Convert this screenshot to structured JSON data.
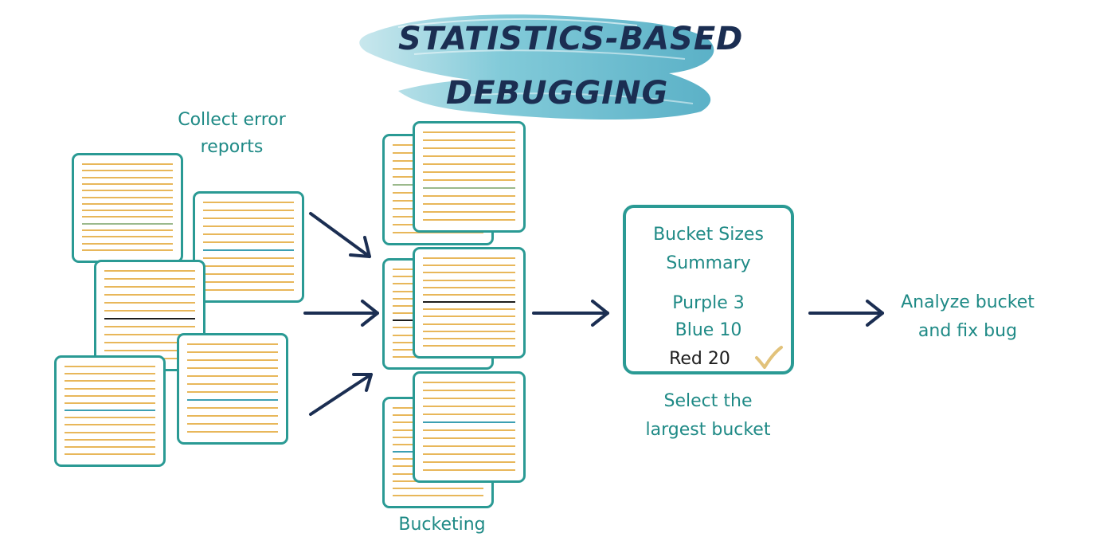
{
  "title": {
    "line1": "STATISTICS-BASED",
    "line2": "DEBUGGING"
  },
  "steps": {
    "collect": {
      "line1": "Collect error",
      "line2": "reports"
    },
    "bucketing": "Bucketing",
    "select": {
      "line1": "Select the",
      "line2": "largest bucket"
    },
    "analyze": {
      "line1": "Analyze bucket",
      "line2": "and fix bug"
    }
  },
  "summary": {
    "heading1": "Bucket Sizes",
    "heading2": "Summary",
    "items": [
      {
        "label": "Purple 3",
        "color": "#2a9a94"
      },
      {
        "label": "Blue 10",
        "color": "#2a9a94"
      },
      {
        "label": "Red 20",
        "color": "#1d1d1d",
        "checked": true
      }
    ]
  },
  "colors": {
    "teal": "#2a9a94",
    "navy": "#1b2e52",
    "orange_line": "#e8b75a",
    "blue_line": "#3c9fb3",
    "check": "#e2c27a"
  }
}
